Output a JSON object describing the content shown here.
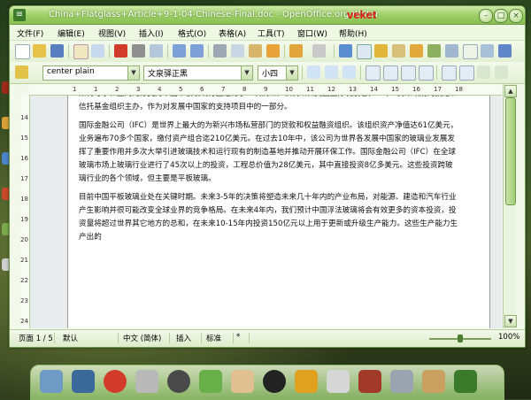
{
  "window": {
    "title": "China+Flatglass+Article+9-1-04-Chinese-Final.doc - OpenOffice.org Writer",
    "brand": "veket"
  },
  "menubar": {
    "items": [
      "文件(F)",
      "编辑(E)",
      "视图(V)",
      "插入(I)",
      "格式(O)",
      "表格(A)",
      "工具(T)",
      "窗口(W)",
      "帮助(H)"
    ]
  },
  "format_toolbar": {
    "paragraph_style": "center plain",
    "font_name": "文泉驿正黑",
    "font_size": "小四"
  },
  "ruler": {
    "numbers": [
      "1",
      "1",
      "2",
      "3",
      "4",
      "5",
      "6",
      "7",
      "8",
      "9",
      "10",
      "11",
      "12",
      "13",
      "14",
      "15",
      "16",
      "17",
      "18"
    ],
    "vertical_numbers": [
      "14",
      "15",
      "16",
      "17",
      "18",
      "19",
      "20",
      "21",
      "22",
      "23",
      "24"
    ]
  },
  "document": {
    "paragraphs": [
      "斯特夸尔和上海的分支对中国平板玻璃行业进行了一次调研。该调研由美国国际发展署(TDA)一贷来政府的捐赠和信托基金组织主办，作为对发展中国家的支持项目中的一部分。",
      "国际金融公司（IFC）是世界上最大的为新兴市场私营部门的贷款和权益融资组织。该组织资产净值达61亿美元，业务遍布70多个国家，缴付资产组合迄210亿美元。在过去10年中，该公司为世界各发展中国家的玻璃业发展发挥了重要作用并多次大举引进玻璃技术和运行现有的制造基地并推动开展环保工作。国际金融公司（IFC）在全球玻璃市场上玻璃行业进行了45次以上的投资，工程总价值为28亿美元，其中直接投资8亿多美元。这些投资跨玻璃行业的各个领域，但主要是平板玻璃。",
      "目前中国平板玻璃业处在关键时期。未来3-5年的决策将塑造未来几十年内的产业布局，对能源、建造和汽车行业产生影响并很可能改变全球业界的竞争格局。在未来4年内，我们预计中国浮法玻璃将会有效更多的资本投资，投资量将超过世界其它地方的总和，在未来10-15年内投资150亿元以上用于更新或升级生产能力。这些生产能力生产出的"
    ]
  },
  "statusbar": {
    "page": "页面 1 / 5",
    "style": "默认",
    "language": "中文 (简体)",
    "insert_mode": "插入",
    "selection": "标准",
    "modified": "*",
    "zoom": "100%"
  },
  "colors": {
    "titlebar": "#9fd068",
    "brand": "#e01818",
    "accent": "#6a9a4a"
  }
}
